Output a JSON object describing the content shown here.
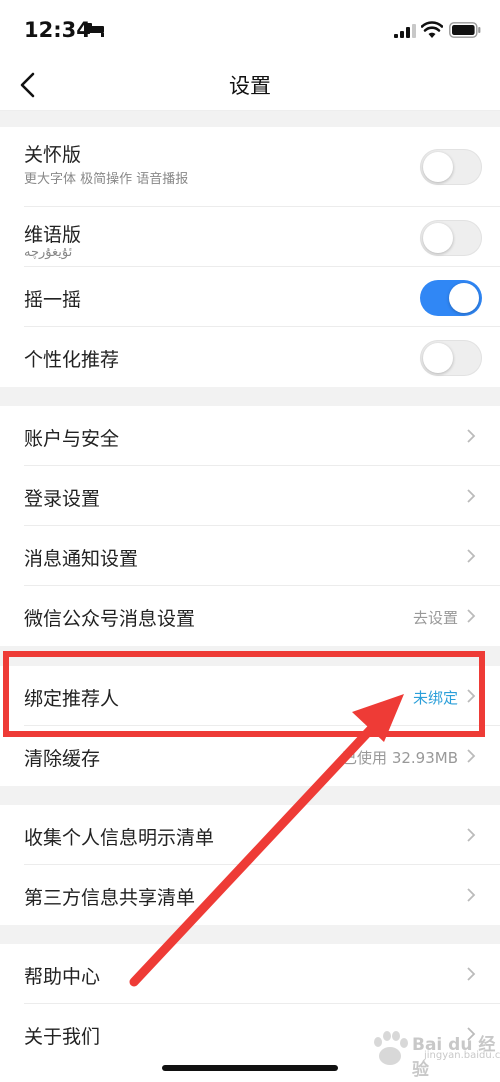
{
  "status_bar": {
    "time": "12:34",
    "icons": [
      "bed-icon",
      "signal-icon",
      "wifi-icon",
      "battery-icon"
    ]
  },
  "nav": {
    "title": "设置",
    "back_icon": "chevron-left-icon"
  },
  "toggle_group": {
    "items": [
      {
        "label": "关怀版",
        "sublabel": "更大字体 极简操作 语音播报",
        "enabled": false
      },
      {
        "label": "维语版",
        "sublabel": "ئۇيغۇرچە",
        "enabled": false
      },
      {
        "label": "摇一摇",
        "enabled": true
      },
      {
        "label": "个性化推荐",
        "enabled": false
      }
    ]
  },
  "account_group": {
    "items": [
      {
        "label": "账户与安全"
      },
      {
        "label": "登录设置"
      },
      {
        "label": "消息通知设置"
      },
      {
        "label": "微信公众号消息设置",
        "value": "去设置"
      }
    ]
  },
  "referrer_group": {
    "items": [
      {
        "label": "绑定推荐人",
        "value": "未绑定"
      },
      {
        "label": "清除缓存",
        "value": "已使用 32.93MB"
      }
    ]
  },
  "privacy_group": {
    "items": [
      {
        "label": "收集个人信息明示清单"
      },
      {
        "label": "第三方信息共享清单"
      }
    ]
  },
  "help_group": {
    "items": [
      {
        "label": "帮助中心"
      },
      {
        "label": "关于我们"
      }
    ]
  },
  "watermark": {
    "text": "Bai du 经验",
    "sub": "jingyan.baidu.com"
  },
  "colors": {
    "toggle_on": "#3087f5",
    "accent_blue_text": "#2b9fd9",
    "annotation_red": "#ee3b36"
  }
}
